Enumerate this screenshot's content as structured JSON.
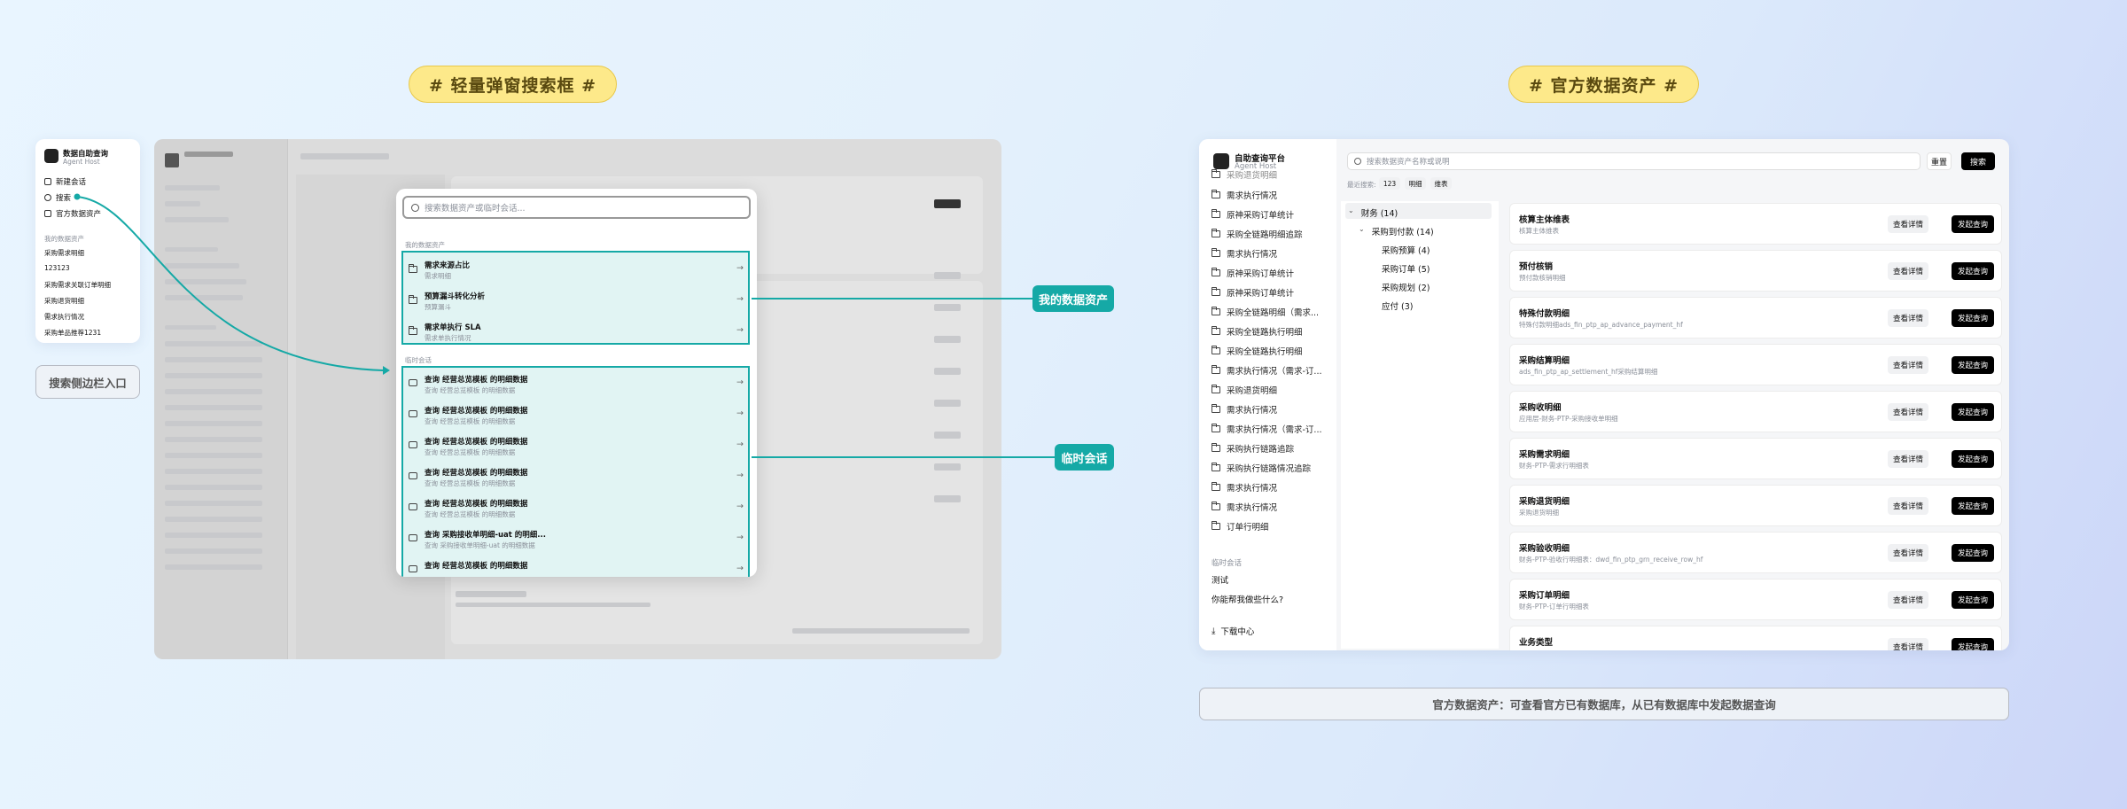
{
  "titles": {
    "left": "# 轻量弹窗搜索框 #",
    "right": "# 官方数据资产 #"
  },
  "sidebar": {
    "app_name": "数据自助查询",
    "app_sub": "Agent Host",
    "items": [
      "新建会话",
      "搜索",
      "官方数据资产"
    ],
    "section": "我的数据资产",
    "history": [
      "采购需求明细",
      "123123",
      "采购需求关联订单明细",
      "采购退货明细",
      "需求执行情况",
      "采购单品推荐1231"
    ]
  },
  "left_caption": "搜索侧边栏入口",
  "popup": {
    "placeholder": "搜索数据资产或临时会话...",
    "section1": "我的数据资产",
    "assets": [
      {
        "t": "需求来源占比",
        "s": "需求明细"
      },
      {
        "t": "预算漏斗转化分析",
        "s": "预算漏斗"
      },
      {
        "t": "需求单执行 SLA",
        "s": "需求单执行情况"
      }
    ],
    "section2": "临时会话",
    "chats": [
      {
        "t": "查询 经营总览模板 的明细数据",
        "s": "查询 经营总览模板 的明细数据"
      },
      {
        "t": "查询 经营总览模板 的明细数据",
        "s": "查询 经营总览模板 的明细数据"
      },
      {
        "t": "查询 经营总览模板 的明细数据",
        "s": "查询 经营总览模板 的明细数据"
      },
      {
        "t": "查询 经营总览模板 的明细数据",
        "s": "查询 经营总览模板 的明细数据"
      },
      {
        "t": "查询 经营总览模板 的明细数据",
        "s": "查询 经营总览模板 的明细数据"
      },
      {
        "t": "查询 采购接收单明细-uat 的明细...",
        "s": "查询 采购接收单明细-uat 的明细数据"
      },
      {
        "t": "查询 经营总览模板 的明细数据",
        "s": "查询 经营总览模板 的明细数据"
      }
    ]
  },
  "tags": {
    "my_assets": "我的数据资产",
    "temp": "临时会话"
  },
  "right": {
    "app_name": "自助查询平台",
    "app_sub": "Agent Host",
    "top_clip": "采购退货明细",
    "folders": [
      "需求执行情况",
      "原神采购订单统计",
      "采购全链路明细追踪",
      "需求执行情况",
      "原神采购订单统计",
      "原神采购订单统计",
      "采购全链路明细（需求...",
      "采购全链路执行明细",
      "采购全链路执行明细",
      "需求执行情况（需求-订...",
      "采购退货明细",
      "需求执行情况",
      "需求执行情况（需求-订...",
      "采购执行链路追踪",
      "采购执行链路情况追踪",
      "需求执行情况",
      "需求执行情况",
      "订单行明细"
    ],
    "temp_label": "临时会话",
    "temp_items": [
      "测试",
      "你能帮我做些什么?"
    ],
    "download": "下载中心",
    "search_ph": "搜索数据资产名称或说明",
    "reset": "重置",
    "search_btn": "搜索",
    "recent": "最近搜索:",
    "recent_tags": [
      "123",
      "明细",
      "维表"
    ],
    "tree": [
      {
        "l": "财务 (14)",
        "d": 0,
        "c": "⌄"
      },
      {
        "l": "采购到付款 (14)",
        "d": 1,
        "c": "⌄"
      },
      {
        "l": "采购预算 (4)",
        "d": 2,
        "c": ""
      },
      {
        "l": "采购订单 (5)",
        "d": 2,
        "c": ""
      },
      {
        "l": "采购规划 (2)",
        "d": 2,
        "c": ""
      },
      {
        "l": "应付 (3)",
        "d": 2,
        "c": ""
      }
    ],
    "cards": [
      {
        "t": "核算主体维表",
        "s": "核算主体维表"
      },
      {
        "t": "预付核销",
        "s": "预付款核销明细"
      },
      {
        "t": "特殊付款明细",
        "s": "特殊付款明细ads_fin_ptp_ap_advance_payment_hf"
      },
      {
        "t": "采购结算明细",
        "s": "ads_fin_ptp_ap_settlement_hf采购结算明细"
      },
      {
        "t": "采购收明细",
        "s": "应用层-财务-PTP-采购接收单明细"
      },
      {
        "t": "采购需求明细",
        "s": "财务-PTP-需求行明细表"
      },
      {
        "t": "采购退货明细",
        "s": "采购退货明细"
      },
      {
        "t": "采购验收明细",
        "s": "财务-PTP-验收行明细表：dwd_fin_ptp_grn_receive_row_hf"
      },
      {
        "t": "采购订单明细",
        "s": "财务-PTP-订单行明细表"
      },
      {
        "t": "业务类型",
        "s": ""
      }
    ],
    "btn_detail": "查看详情",
    "btn_query": "发起查询"
  },
  "right_caption": "官方数据资产：可查看官方已有数据库，从已有数据库中发起数据查询"
}
